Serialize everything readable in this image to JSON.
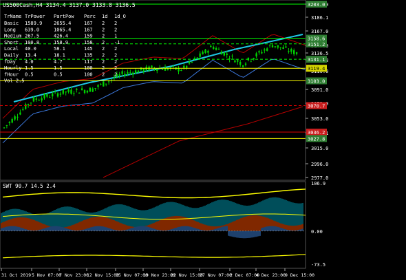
{
  "colors": {
    "background": "#000000",
    "text": "#ffffff",
    "grid": "#ffffff",
    "candle": "#00d200",
    "ma_cyan": "#1ec8e6",
    "channel_red": "#b40000",
    "channel_blue": "#3c78dc",
    "level_yellow": "#ffff00",
    "level_green": "#00ff00",
    "level_red": "#dc0000",
    "swt_orange": "#ff5000",
    "swt_blue": "#3c82dc",
    "swt_teal": "#009bb4",
    "badge_red": "#c81e1e",
    "badge_yellow": "#d4d400"
  },
  "header": {
    "title": "US500Cash,H4 3134.4 3137.0 3133.8 3136.5"
  },
  "table": {
    "columns": [
      "TrName",
      "TrPower",
      "PartPow",
      "Perc",
      "1d",
      "1d_O"
    ],
    "rows": [
      [
        "Basic",
        "1589.9",
        "2655.4",
        "167",
        "2",
        "2"
      ],
      [
        "Long",
        "639.0",
        "1065.4",
        "167",
        "2",
        "2"
      ],
      [
        "Medium",
        "267.5",
        "426.4",
        "159",
        "2",
        "1"
      ],
      [
        "Short",
        "100.8",
        "158.9",
        "158",
        "2",
        "-1"
      ],
      [
        "Local",
        "40.0",
        "58.1",
        "145",
        "2",
        "2"
      ],
      [
        "Daily",
        "13.4",
        "18.1",
        "135",
        "2",
        "2"
      ],
      [
        "fDay",
        "4.0",
        "4.7",
        "117",
        "2",
        "2"
      ],
      [
        "Hourly",
        "1.5",
        "1.5",
        "100",
        "2",
        "2"
      ],
      [
        "fHour",
        "0.5",
        "0.5",
        "100",
        "2",
        "2"
      ],
      [
        "Vol 2.5",
        "",
        "",
        "",
        "",
        ""
      ]
    ]
  },
  "price_axis": {
    "ticks": [
      "3203.0",
      "3186.1",
      "3167.0",
      "3147.9",
      "3136.5",
      "3128.8",
      "3110.0",
      "3091.0",
      "3072.0",
      "3053.0",
      "3034.1",
      "3015.0",
      "2996.0",
      "2977.0"
    ],
    "badges": [
      {
        "label": "3203.0",
        "kind": "green",
        "price": 3203.0
      },
      {
        "label": "3158.6",
        "kind": "green",
        "price": 3158.6
      },
      {
        "label": "3151.2",
        "kind": "green",
        "price": 3151.2
      },
      {
        "label": "3131.1",
        "kind": "green",
        "price": 3131.1
      },
      {
        "label": "3119.4",
        "kind": "yellow",
        "price": 3119.4
      },
      {
        "label": "3103.0",
        "kind": "green",
        "price": 3103.0
      },
      {
        "label": "3070.7",
        "kind": "red",
        "price": 3070.7
      },
      {
        "label": "3036.2",
        "kind": "red",
        "price": 3036.2
      },
      {
        "label": "3027.8",
        "kind": "green",
        "price": 3027.8
      }
    ]
  },
  "levels": [
    {
      "price": 3203.0,
      "color": "green",
      "style": "solid"
    },
    {
      "price": 3158.6,
      "color": "green",
      "style": "solid"
    },
    {
      "price": 3151.2,
      "color": "green",
      "style": "dashed"
    },
    {
      "price": 3131.1,
      "color": "green",
      "style": "dashed"
    },
    {
      "price": 3119.4,
      "color": "yellow",
      "style": "solid"
    },
    {
      "price": 3103.0,
      "color": "yellow",
      "style": "solid"
    },
    {
      "price": 3070.7,
      "color": "red",
      "style": "dashed"
    },
    {
      "price": 3036.2,
      "color": "red",
      "style": "solid"
    },
    {
      "price": 3027.8,
      "color": "yellow",
      "style": "solid"
    }
  ],
  "swt": {
    "label": "SWT 90.7 14.5 2.4",
    "axis_ticks": [
      "106.9",
      "0.00",
      "-73.5"
    ]
  },
  "time_axis": [
    "31 Oct 2019",
    "5 Nov 07:00",
    "7 Nov 23:00",
    "12 Nov 15:00",
    "15 Nov 07:00",
    "19 Nov 23:00",
    "22 Nov 15:00",
    "27 Nov 07:00",
    "2 Dec 07:00",
    "4 Dec 23:00",
    "9 Dec 15:00"
  ],
  "chart_data": {
    "type": "line",
    "symbol": "US500Cash",
    "timeframe": "H4",
    "ylim": [
      2977.0,
      3210.0
    ],
    "x": [
      "31 Oct 2019",
      "5 Nov 07:00",
      "7 Nov 23:00",
      "12 Nov 15:00",
      "15 Nov 07:00",
      "19 Nov 23:00",
      "22 Nov 15:00",
      "27 Nov 07:00",
      "2 Dec 07:00",
      "4 Dec 23:00",
      "9 Dec 15:00"
    ],
    "series": [
      {
        "values": [
          3040,
          3078,
          3088,
          3092,
          3112,
          3120,
          3118,
          3148,
          3125,
          3150,
          3136.5
        ]
      }
    ]
  }
}
